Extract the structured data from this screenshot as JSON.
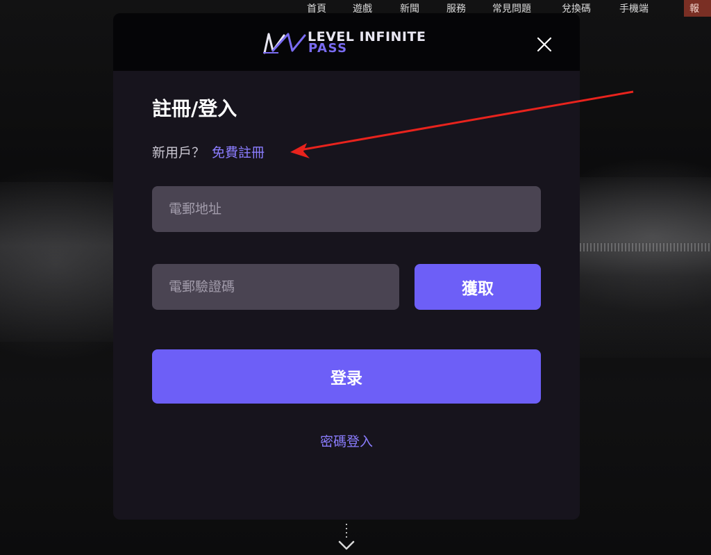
{
  "nav": {
    "items": [
      "首頁",
      "遊戲",
      "新聞",
      "服務",
      "常見問題",
      "兌換碼",
      "手機端"
    ],
    "report_label": "報"
  },
  "modal": {
    "logo": {
      "line1": "LEVEL INFINITE",
      "line2": "PASS"
    },
    "title": "註冊/登入",
    "new_user_label": "新用戶？",
    "free_register_link": "免費註冊",
    "email_placeholder": "電郵地址",
    "code_placeholder": "電郵驗證碼",
    "get_code_label": "獲取",
    "login_label": "登录",
    "password_login_link": "密碼登入"
  },
  "icons": {
    "close": "close-icon",
    "logo": "level-infinite-logo-icon",
    "scroll": "scroll-down-icon",
    "annotation": "red-arrow-annotation"
  },
  "colors": {
    "accent": "#6d5ff7",
    "link": "#8b7dff",
    "modal_bg": "#17141d",
    "input_bg": "#4a4452",
    "annotation": "#e8231d"
  }
}
